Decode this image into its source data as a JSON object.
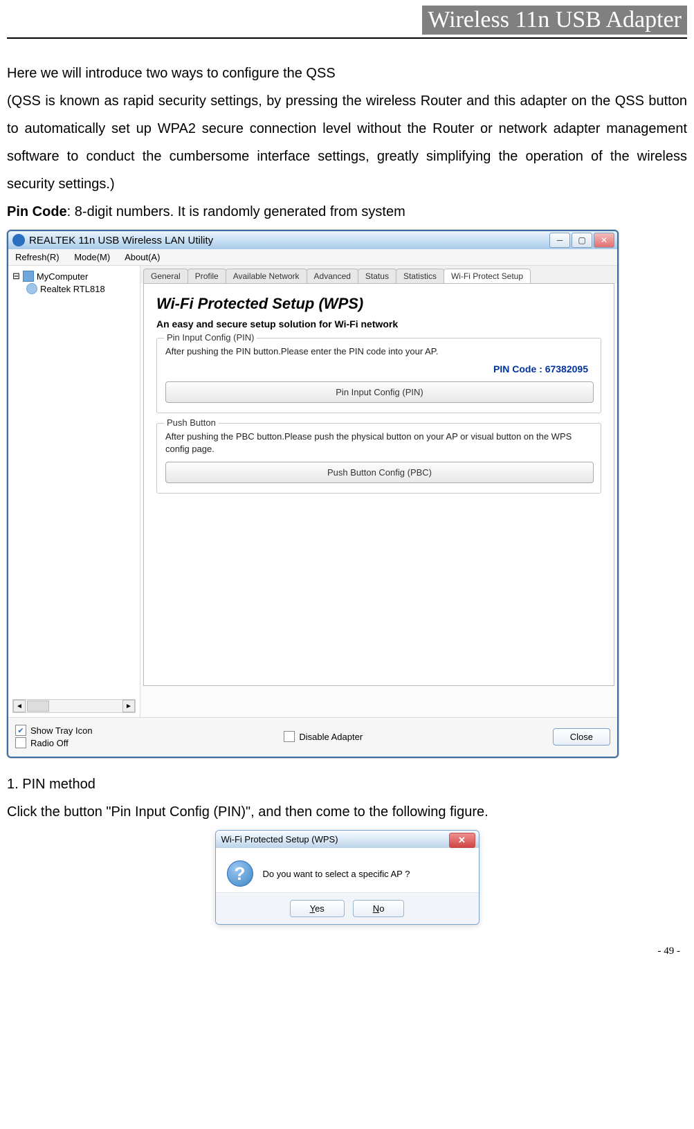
{
  "header": "Wireless 11n USB Adapter",
  "para1": "Here we will introduce two ways to configure the QSS",
  "para2": "(QSS is known as rapid security settings, by pressing the wireless Router and this adapter on the QSS button to automatically set up WPA2 secure connection level without the Router or network adapter management software to conduct the cumbersome interface settings, greatly simplifying the operation of the wireless security settings.)",
  "para3_label": "Pin Code",
  "para3_rest": ": 8-digit numbers. It is randomly generated from system",
  "utility": {
    "title": "REALTEK 11n USB Wireless LAN Utility",
    "menus": [
      "Refresh(R)",
      "Mode(M)",
      "About(A)"
    ],
    "tree": {
      "root": "MyComputer",
      "child": "Realtek RTL818"
    },
    "tabs": [
      "General",
      "Profile",
      "Available Network",
      "Advanced",
      "Status",
      "Statistics",
      "Wi-Fi Protect Setup"
    ],
    "active_tab_index": 6,
    "wps": {
      "heading": "Wi-Fi Protected Setup (WPS)",
      "subtitle": "An easy and secure setup solution for Wi-Fi network",
      "pin_group": {
        "legend": "Pin Input Config (PIN)",
        "desc": "After pushing the PIN button.Please enter the PIN code into your AP.",
        "pin_label": "PIN Code :  67382095",
        "button": "Pin Input Config (PIN)"
      },
      "pbc_group": {
        "legend": "Push Button",
        "desc": "After pushing the PBC button.Please push the physical button on your AP or visual button on the WPS config page.",
        "button": "Push Button Config (PBC)"
      }
    },
    "footer": {
      "show_tray": {
        "label": "Show Tray Icon",
        "checked": true
      },
      "radio_off": {
        "label": "Radio Off",
        "checked": false
      },
      "disable_adapter": {
        "label": "Disable Adapter",
        "checked": false
      },
      "close": "Close"
    }
  },
  "list_item": "1.    PIN method",
  "para4": "Click the button \"Pin Input Config (PIN)\", and then come to the following figure.",
  "dialog": {
    "title": "Wi-Fi Protected Setup (WPS)",
    "message": "Do you want to select a specific AP ?",
    "yes_prefix": "Y",
    "yes_rest": "es",
    "no_prefix": "N",
    "no_rest": "o"
  },
  "page_number": "- 49 -"
}
